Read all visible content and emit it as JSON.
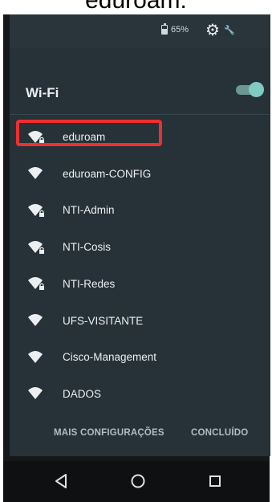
{
  "caption": "eduroam.",
  "status_bar": {
    "battery_text": "65%",
    "settings_icon": "gear-icon",
    "wrench_icon": "wrench-icon"
  },
  "wifi": {
    "title": "Wi-Fi",
    "toggle_on": true,
    "accent_color": "#80cbc4"
  },
  "networks": [
    {
      "name": "eduroam",
      "locked": true
    },
    {
      "name": "eduroam-CONFIG",
      "locked": false
    },
    {
      "name": "NTI-Admin",
      "locked": true
    },
    {
      "name": "NTI-Cosis",
      "locked": true
    },
    {
      "name": "NTI-Redes",
      "locked": true
    },
    {
      "name": "UFS-VISITANTE",
      "locked": false
    },
    {
      "name": "Cisco-Management",
      "locked": false
    },
    {
      "name": "DADOS",
      "locked": false
    }
  ],
  "actions": {
    "more_settings": "MAIS CONFIGURAÇÕES",
    "done": "CONCLUÍDO"
  },
  "navbar": {
    "back_icon": "back-icon",
    "home_icon": "home-icon",
    "recents_icon": "recents-icon"
  },
  "highlight_color": "#ef2f2f"
}
